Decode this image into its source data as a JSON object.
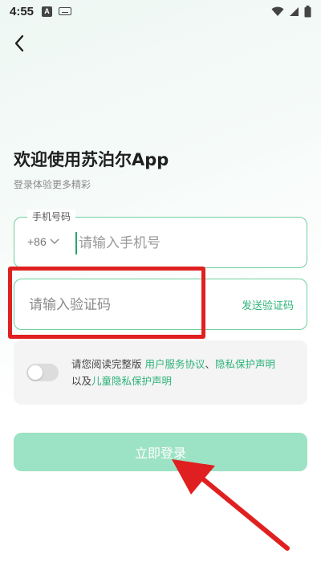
{
  "status_bar": {
    "time": "4:55",
    "notification_icon_letter": "A"
  },
  "header": {
    "back_icon": "chevron-left-icon"
  },
  "welcome": {
    "title": "欢迎使用苏泊尔App",
    "subtitle": "登录体验更多精彩"
  },
  "phone_field": {
    "label": "手机号码",
    "country_code": "+86",
    "placeholder": "请输入手机号"
  },
  "code_field": {
    "placeholder": "请输入验证码",
    "send_label": "发送验证码"
  },
  "agreement": {
    "prefix": "请您阅读完整版 ",
    "user_agreement": "用户服务协议",
    "separator": "、",
    "privacy_policy": "隐私保护声明",
    "and": "以及",
    "children_privacy": "儿童隐私保护声明",
    "toggle_on": false
  },
  "login": {
    "label": "立即登录"
  },
  "colors": {
    "accent": "#2fb37a",
    "border": "#6fcf9f",
    "login_disabled": "#9ce2c4",
    "highlight": "#e02020"
  }
}
